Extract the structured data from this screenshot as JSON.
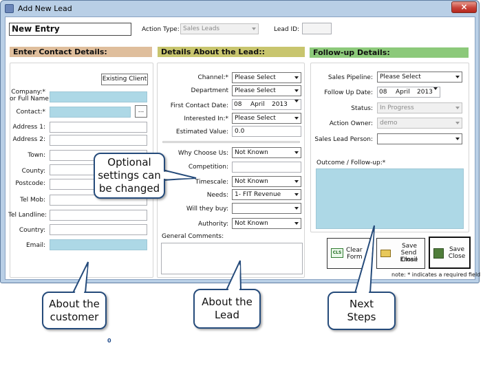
{
  "window": {
    "title": "Add New Lead",
    "close_label": "×"
  },
  "top": {
    "entry_value": "New Entry",
    "action_type_label": "Action Type:",
    "action_type_value": "Sales Leads",
    "lead_id_label": "Lead ID:",
    "lead_id_value": ""
  },
  "contact": {
    "header": "Enter Contact Details:",
    "existing_client_button": "Existing Client",
    "company_label": "Company:*",
    "company_label_2": "or Full Name",
    "contact_label": "Contact:*",
    "contact_button": "...",
    "address1_label": "Address 1:",
    "address2_label": "Address 2:",
    "town_label": "Town:",
    "county_label": "County:",
    "postcode_label": "Postcode:",
    "tel_mob_label": "Tel Mob:",
    "tel_landline_label": "Tel Landline:",
    "country_label": "Country:",
    "email_label": "Email:"
  },
  "lead": {
    "header": "Details About the Lead::",
    "channel_label": "Channel:*",
    "channel_value": "Please Select",
    "department_label": "Department",
    "department_value": "Please Select",
    "first_contact_label": "First Contact Date:",
    "first_contact_day": "08",
    "first_contact_month": "April",
    "first_contact_year": "2013",
    "interested_label": "Interested In:*",
    "interested_value": "Please Select",
    "estimated_label": "Estimated Value:",
    "estimated_value": "0.0",
    "why_label": "Why Choose Us:",
    "why_value": "Not Known",
    "competition_label": "Competition:",
    "timescale_label": "Timescale:",
    "timescale_value": "Not Known",
    "needs_label": "Needs:",
    "needs_value": "1- FIT Revenue",
    "will_buy_label": "Will they buy:",
    "will_buy_value": "",
    "authority_label": "Authority:",
    "authority_value": "Not Known",
    "comments_label": "General Comments:"
  },
  "followup": {
    "header": "Follow-up Details:",
    "pipeline_label": "Sales Pipeline:",
    "pipeline_value": "Please Select",
    "date_label": "Follow Up Date:",
    "date_day": "08",
    "date_month": "April",
    "date_year": "2013",
    "status_label": "Status:",
    "status_value": "In Progress",
    "owner_label": "Action Owner:",
    "owner_value": "demo",
    "person_label": "Sales Lead Person:",
    "person_value": "",
    "outcome_label": "Outcome / Follow-up:*"
  },
  "buttons": {
    "clear_line1": "Clear",
    "clear_line2": "Form",
    "clear_icon_text": "CLS",
    "save_send_line1": "Save",
    "save_send_line2": "Send Email",
    "save_send_line3": "Close",
    "save_close_line1": "Save",
    "save_close_line2": "Close"
  },
  "note": "note: * indicates a required field",
  "callouts": {
    "optional_line1": "Optional",
    "optional_line2": "settings can",
    "optional_line3": "be changed",
    "customer_line1": "About the",
    "customer_line2": "customer",
    "lead_line1": "About the",
    "lead_line2": "Lead",
    "next_line1": "Next",
    "next_line2": "Steps"
  },
  "stray_mark": "0",
  "colors": {
    "contact_header": "#dfbe9c",
    "lead_header": "#c8c56e",
    "followup_header": "#8cc97a",
    "required_field": "#add8e6",
    "callout_border": "#244a7a"
  }
}
